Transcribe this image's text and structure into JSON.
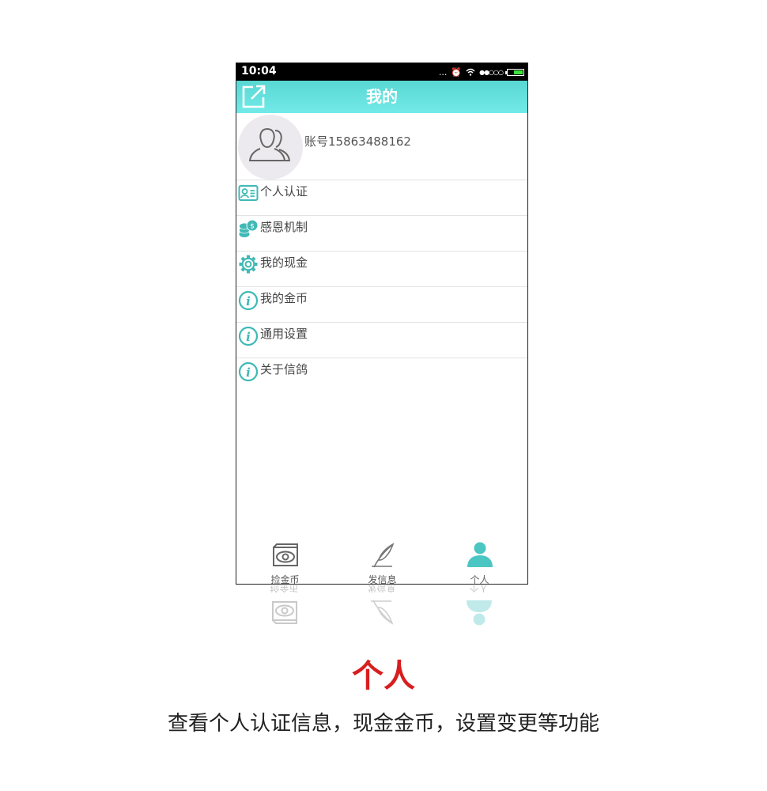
{
  "status_bar": {
    "time": "10:04",
    "signal_text": "...",
    "dots": "●●○○○"
  },
  "header": {
    "title": "我的"
  },
  "profile": {
    "account": "账号15863488162"
  },
  "menu": {
    "items": [
      {
        "label": "个人认证",
        "icon": "id-card-icon"
      },
      {
        "label": "感恩机制",
        "icon": "coins-icon"
      },
      {
        "label": "我的现金",
        "icon": "gear-icon"
      },
      {
        "label": "我的金币",
        "icon": "info-icon"
      },
      {
        "label": "通用设置",
        "icon": "info-icon"
      },
      {
        "label": "关于信鸽",
        "icon": "info-icon"
      }
    ]
  },
  "tabs": [
    {
      "label": "捡金币",
      "icon": "eye-card-icon"
    },
    {
      "label": "发信息",
      "icon": "feather-icon"
    },
    {
      "label": "个人",
      "icon": "person-icon",
      "active": true
    }
  ],
  "caption": {
    "title": "个人",
    "description": "查看个人认证信息，现金金币，设置变更等功能"
  },
  "colors": {
    "accent": "#5dd8d4",
    "caption_red": "#d81e1e",
    "icon_teal": "#3fb9b5"
  }
}
